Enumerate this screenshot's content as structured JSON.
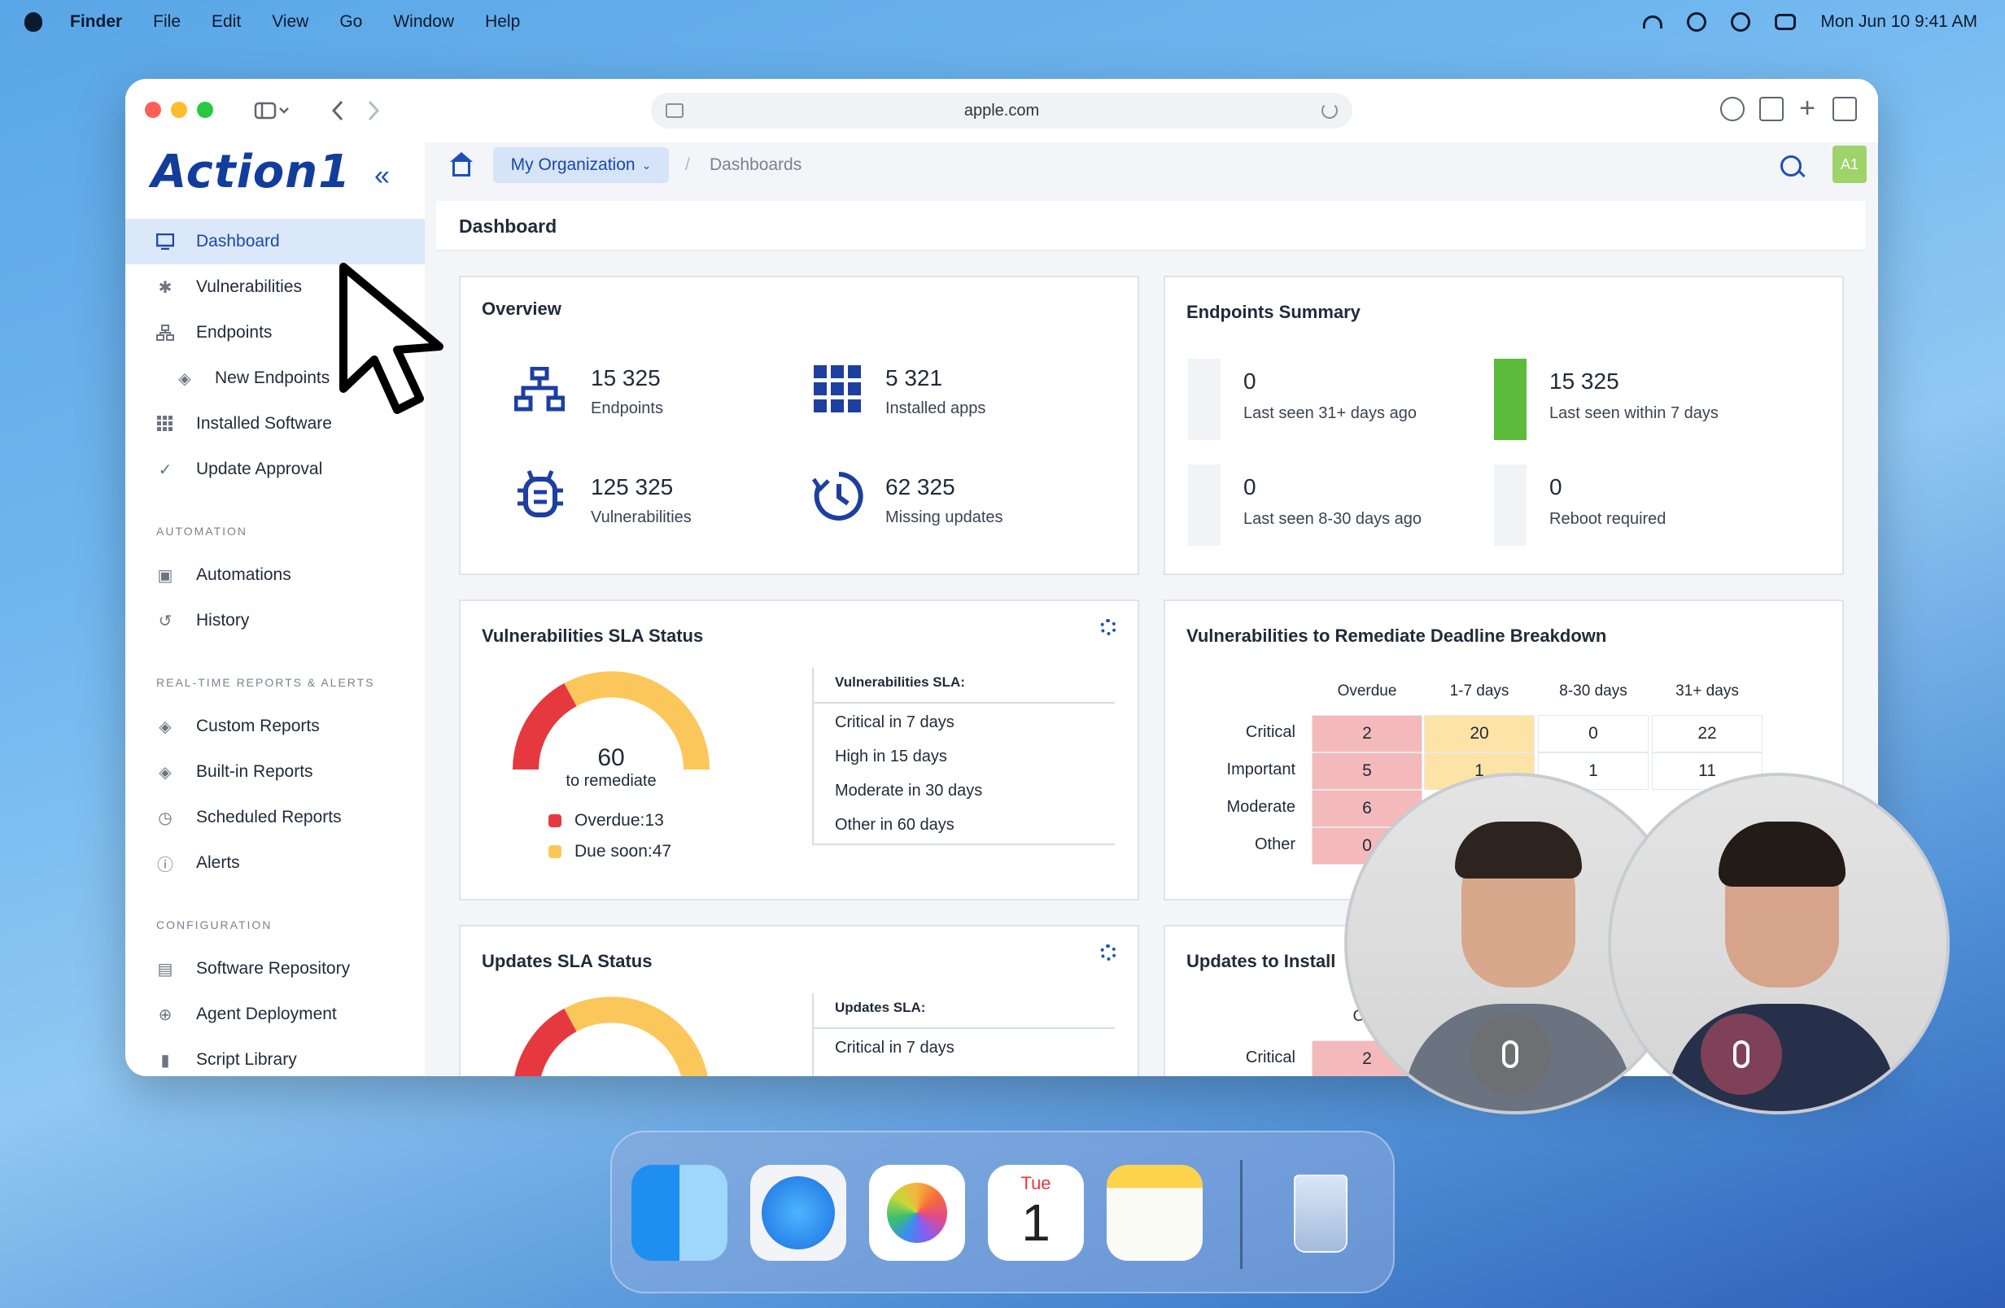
{
  "menubar": {
    "app_name": "Finder",
    "items": [
      "File",
      "Edit",
      "View",
      "Go",
      "Window",
      "Help"
    ],
    "clock": "Mon Jun 10  9:41 AM"
  },
  "browser": {
    "url": "apple.com"
  },
  "brand": {
    "logo_text": "Action1"
  },
  "sidebar": {
    "items": [
      {
        "label": "Dashboard",
        "icon": "monitor-icon"
      },
      {
        "label": "Vulnerabilities",
        "icon": "bug-icon"
      },
      {
        "label": "Endpoints",
        "icon": "network-icon"
      },
      {
        "label": "New Endpoints",
        "icon": "layers-icon"
      },
      {
        "label": "Installed Software",
        "icon": "grid-icon"
      },
      {
        "label": "Update Approval",
        "icon": "check-icon"
      }
    ],
    "automation_title": "AUTOMATION",
    "automation_items": [
      {
        "label": "Automations",
        "icon": "calendar-icon"
      },
      {
        "label": "History",
        "icon": "history-icon"
      }
    ],
    "reports_title": "REAL-TIME REPORTS & ALERTS",
    "reports_items": [
      {
        "label": "Custom Reports",
        "icon": "layers-icon"
      },
      {
        "label": "Built-in Reports",
        "icon": "layers-icon"
      },
      {
        "label": "Scheduled Reports",
        "icon": "clock-icon"
      },
      {
        "label": "Alerts",
        "icon": "alert-icon"
      }
    ],
    "config_title": "CONFIGURATION",
    "config_items": [
      {
        "label": "Software Repository",
        "icon": "package-icon"
      },
      {
        "label": "Agent Deployment",
        "icon": "search-icon"
      },
      {
        "label": "Script Library",
        "icon": "script-icon"
      }
    ]
  },
  "topnav": {
    "org": "My Organization",
    "sep": "/",
    "crumb": "Dashboards",
    "avatar": "A1"
  },
  "page": {
    "title": "Dashboard"
  },
  "overview": {
    "title": "Overview",
    "stats": [
      {
        "value": "15 325",
        "label": "Endpoints"
      },
      {
        "value": "5 321",
        "label": "Installed apps"
      },
      {
        "value": "125 325",
        "label": "Vulnerabilities"
      },
      {
        "value": "62 325",
        "label": "Missing updates"
      }
    ]
  },
  "endpoints_summary": {
    "title": "Endpoints Summary",
    "items": [
      {
        "value": "0",
        "label": "Last seen 31+ days ago"
      },
      {
        "value": "15 325",
        "label": "Last seen within 7 days"
      },
      {
        "value": "0",
        "label": "Last seen 8-30 days ago"
      },
      {
        "value": "0",
        "label": "Reboot required"
      }
    ]
  },
  "vuln_sla": {
    "title": "Vulnerabilities SLA Status",
    "gauge_value": "60",
    "gauge_label": "to remediate",
    "overdue_label": "Overdue:",
    "overdue_value": "13",
    "due_soon_label": "Due soon:",
    "due_soon_value": "47",
    "sla_title": "Vulnerabilities SLA:",
    "sla_items": [
      "Critical in 7 days",
      "High in 15 days",
      "Moderate in 30 days",
      "Other in 60 days"
    ],
    "colors": {
      "overdue": "#e5393f",
      "due_soon": "#fcc75a"
    }
  },
  "deadline": {
    "title": "Vulnerabilities to Remediate Deadline Breakdown",
    "columns": [
      "Overdue",
      "1-7 days",
      "8-30 days",
      "31+ days"
    ],
    "rows": [
      {
        "label": "Critical",
        "values": [
          "2",
          "20",
          "0",
          "22"
        ]
      },
      {
        "label": "Important",
        "values": [
          "5",
          "1",
          "1",
          "11"
        ]
      },
      {
        "label": "Moderate",
        "values": [
          "6",
          "",
          "",
          ""
        ]
      },
      {
        "label": "Other",
        "values": [
          "0",
          "",
          "",
          ""
        ]
      }
    ]
  },
  "updates_sla": {
    "title": "Updates SLA Status",
    "sla_title": "Updates SLA:",
    "sla_items": [
      "Critical in 7 days"
    ]
  },
  "updates_install": {
    "title": "Updates to Install",
    "col": "Ove",
    "row_label": "Critical",
    "row_value": "2"
  },
  "dock": {
    "calendar_day": "Tue",
    "calendar_date": "1"
  }
}
